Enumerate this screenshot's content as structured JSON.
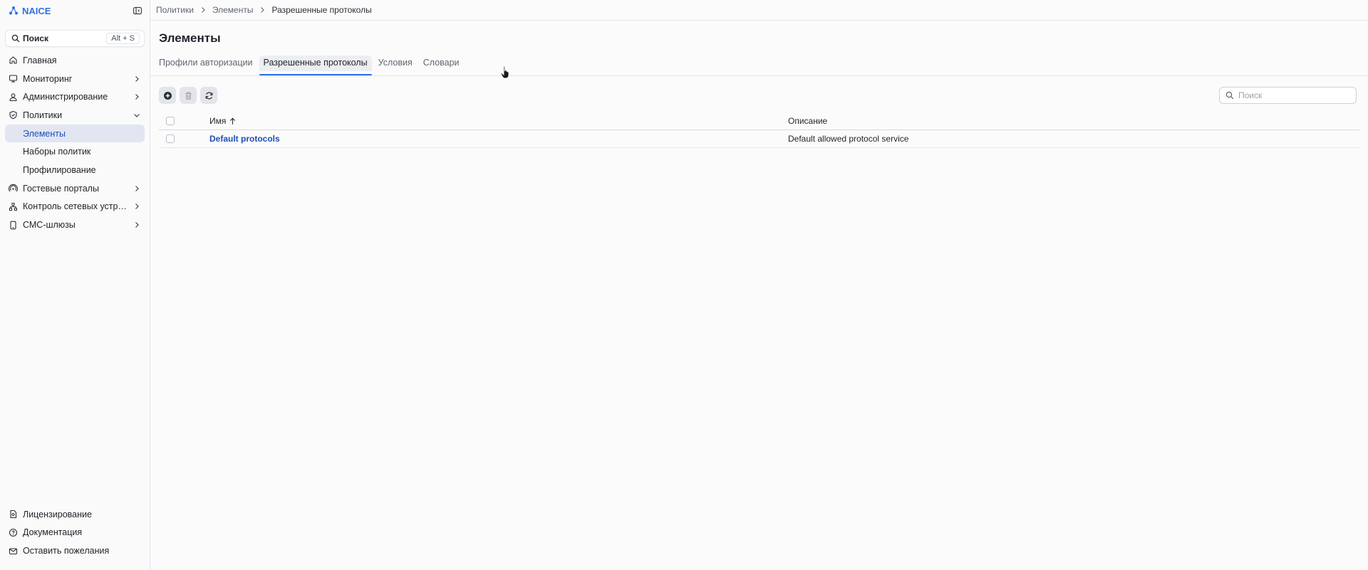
{
  "app": {
    "name": "NAICE",
    "accent": "#2f6fe4"
  },
  "sidebar": {
    "search": {
      "label": "Поиск",
      "shortcut": "Alt + S"
    },
    "items": [
      {
        "label": "Главная",
        "icon": "home-icon"
      },
      {
        "label": "Мониторинг",
        "icon": "monitor-icon",
        "expandable": true
      },
      {
        "label": "Администрирование",
        "icon": "user-icon",
        "expandable": true
      },
      {
        "label": "Политики",
        "icon": "shield-icon",
        "expanded": true,
        "children": [
          {
            "label": "Элементы",
            "active": true
          },
          {
            "label": "Наборы политик"
          },
          {
            "label": "Профилирование"
          }
        ]
      },
      {
        "label": "Гостевые порталы",
        "icon": "wifi-portal-icon",
        "expandable": true
      },
      {
        "label": "Контроль сетевых устро...",
        "icon": "network-icon",
        "expandable": true
      },
      {
        "label": "СМС-шлюзы",
        "icon": "phone-icon",
        "expandable": true
      }
    ],
    "bottom": [
      {
        "label": "Лицензирование",
        "icon": "license-icon"
      },
      {
        "label": "Документация",
        "icon": "help-icon"
      },
      {
        "label": "Оставить пожелания",
        "icon": "feedback-icon"
      }
    ]
  },
  "breadcrumb": [
    "Политики",
    "Элементы",
    "Разрешенные протоколы"
  ],
  "page": {
    "title": "Элементы",
    "tabs": [
      {
        "label": "Профили авторизации"
      },
      {
        "label": "Разрешенные протоколы",
        "active": true
      },
      {
        "label": "Условия"
      },
      {
        "label": "Словари"
      }
    ]
  },
  "toolbar": {
    "add_icon": "add-icon",
    "delete_icon": "trash-icon",
    "refresh_icon": "refresh-icon",
    "search_placeholder": "Поиск",
    "search_value": ""
  },
  "table": {
    "columns": {
      "name": "Имя",
      "description": "Описание"
    },
    "sort": {
      "column": "name",
      "direction": "asc"
    },
    "rows": [
      {
        "name": "Default protocols",
        "description": "Default allowed protocol service"
      }
    ]
  }
}
